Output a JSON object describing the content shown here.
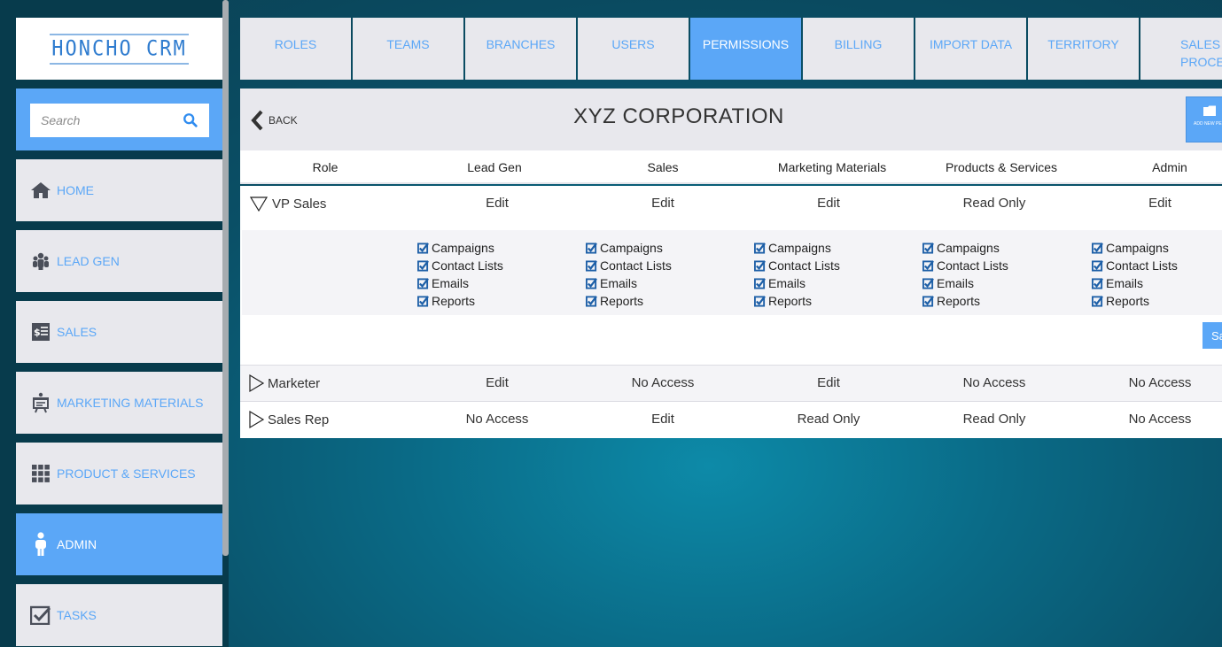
{
  "app": {
    "logo_text": "HONCHO CRM",
    "accent_color": "#5ba7f7"
  },
  "search": {
    "placeholder": "Search",
    "value": ""
  },
  "sidebar": {
    "items": [
      {
        "label": "HOME",
        "icon": "home-icon",
        "active": false
      },
      {
        "label": "LEAD GEN",
        "icon": "users-group-icon",
        "active": false
      },
      {
        "label": "SALES",
        "icon": "receipt-icon",
        "active": false
      },
      {
        "label": "MARKETING MATERIALS",
        "icon": "presentation-icon",
        "active": false
      },
      {
        "label": "PRODUCT & SERVICES",
        "icon": "grid-icon",
        "active": false
      },
      {
        "label": "ADMIN",
        "icon": "person-icon",
        "active": true
      },
      {
        "label": "TASKS",
        "icon": "checkbox-icon",
        "active": false
      }
    ]
  },
  "tabs": [
    {
      "label": "ROLES",
      "active": false
    },
    {
      "label": "TEAMS",
      "active": false
    },
    {
      "label": "BRANCHES",
      "active": false
    },
    {
      "label": "USERS",
      "active": false
    },
    {
      "label": "PERMISSIONS",
      "active": true
    },
    {
      "label": "BILLING",
      "active": false
    },
    {
      "label": "IMPORT DATA",
      "active": false
    },
    {
      "label": "TERRITORY",
      "active": false
    },
    {
      "label": "SALES PROCESS",
      "active": false
    }
  ],
  "panel": {
    "back_label": "BACK",
    "title": "XYZ CORPORATION",
    "add_button_label": "ADD NEW PERMISSION",
    "save_label": "Save"
  },
  "table": {
    "columns": [
      "Role",
      "Lead Gen",
      "Sales",
      "Marketing Materials",
      "Products & Services",
      "Admin"
    ],
    "rows": [
      {
        "role": "VP Sales",
        "expanded": true,
        "values": [
          "Edit",
          "Edit",
          "Edit",
          "Read Only",
          "Edit"
        ]
      },
      {
        "role": "Marketer",
        "expanded": false,
        "values": [
          "Edit",
          "No Access",
          "Edit",
          "No Access",
          "No Access"
        ]
      },
      {
        "role": "Sales Rep",
        "expanded": false,
        "values": [
          "No Access",
          "Edit",
          "Read Only",
          "Read Only",
          "No Access"
        ]
      }
    ],
    "permission_options": [
      {
        "label": "Campaigns",
        "checked": true
      },
      {
        "label": "Contact Lists",
        "checked": true
      },
      {
        "label": "Emails",
        "checked": true
      },
      {
        "label": "Reports",
        "checked": true
      }
    ]
  }
}
